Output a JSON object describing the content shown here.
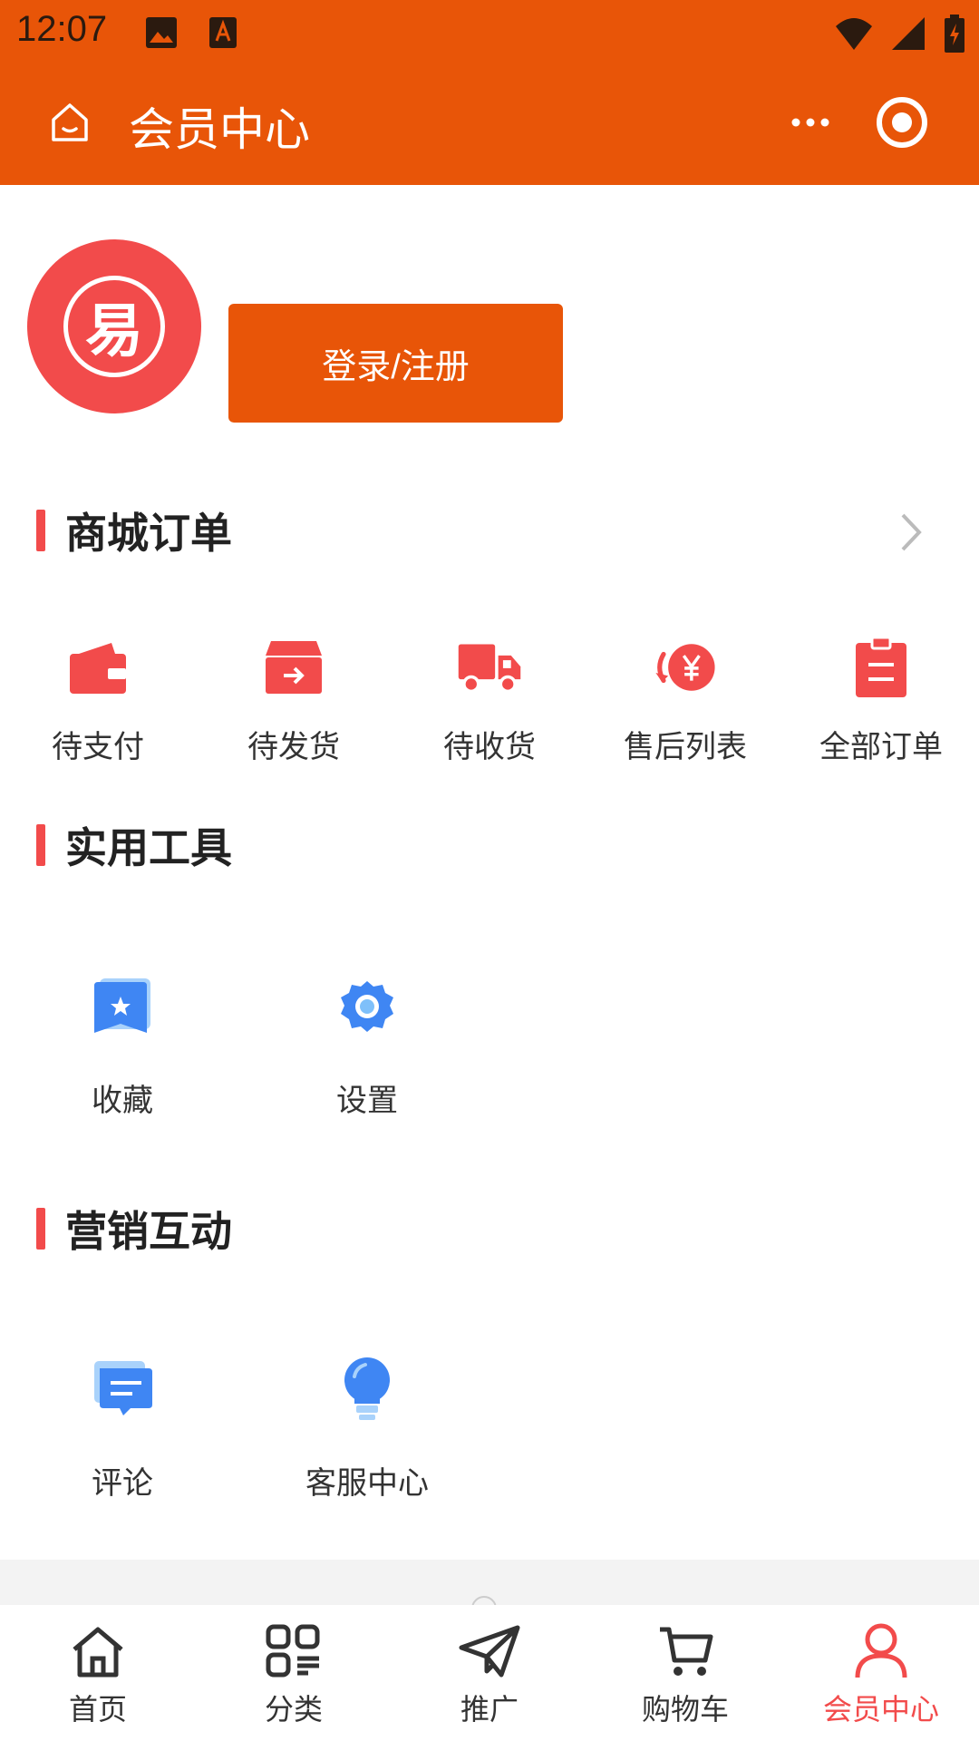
{
  "status_bar": {
    "time": "12:07"
  },
  "header": {
    "title": "会员中心"
  },
  "profile": {
    "avatar_char": "易",
    "login_label": "登录/注册"
  },
  "sections": {
    "orders": "商城订单",
    "tools": "实用工具",
    "marketing": "营销互动"
  },
  "orders": [
    {
      "label": "待支付",
      "icon": "wallet-icon"
    },
    {
      "label": "待发货",
      "icon": "box-arrow-icon"
    },
    {
      "label": "待收货",
      "icon": "truck-icon"
    },
    {
      "label": "售后列表",
      "icon": "yen-refund-icon"
    },
    {
      "label": "全部订单",
      "icon": "clipboard-icon"
    }
  ],
  "tools": [
    {
      "label": "收藏",
      "icon": "star-bookmark-icon"
    },
    {
      "label": "设置",
      "icon": "gear-icon"
    }
  ],
  "marketing": [
    {
      "label": "评论",
      "icon": "comment-icon"
    },
    {
      "label": "客服中心",
      "icon": "lightbulb-icon"
    }
  ],
  "tabs": [
    {
      "label": "首页",
      "icon": "home-icon"
    },
    {
      "label": "分类",
      "icon": "category-icon"
    },
    {
      "label": "推广",
      "icon": "paper-plane-icon"
    },
    {
      "label": "购物车",
      "icon": "cart-icon"
    },
    {
      "label": "会员中心",
      "icon": "user-icon",
      "active": true
    }
  ],
  "colors": {
    "brand_orange": "#E85508",
    "accent_red": "#F24B4B",
    "icon_blue": "#3F86F3"
  }
}
